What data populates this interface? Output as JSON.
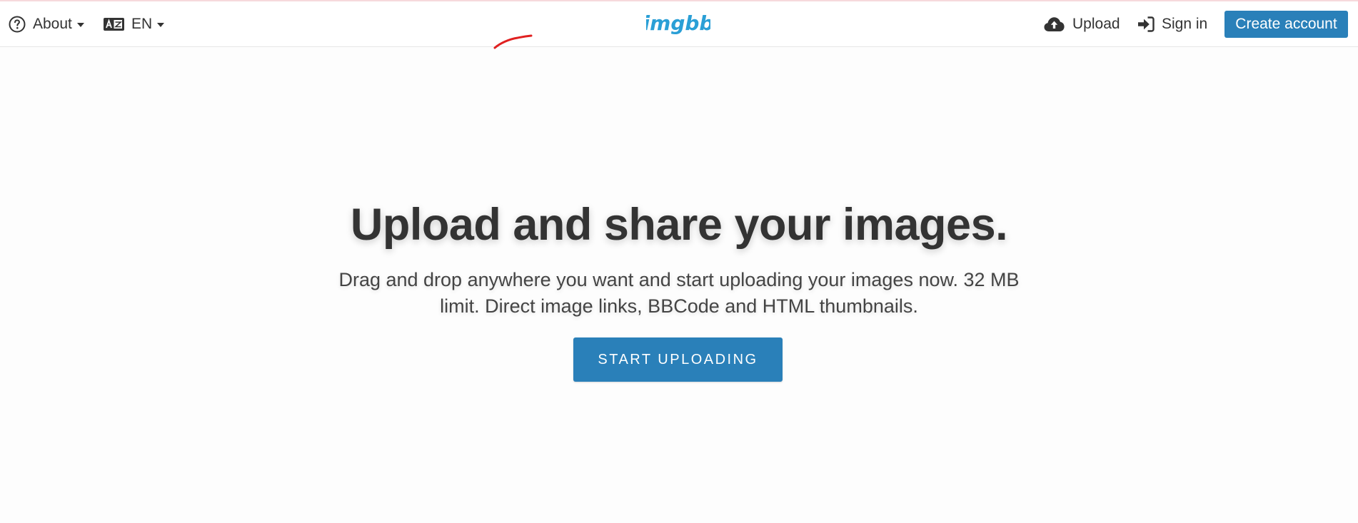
{
  "header": {
    "about_label": "About",
    "language_label": "EN",
    "logo_text": "imgbb",
    "upload_label": "Upload",
    "signin_label": "Sign in",
    "create_account_label": "Create account"
  },
  "hero": {
    "title": "Upload and share your images.",
    "subtitle": "Drag and drop anywhere you want and start uploading your images now. 32 MB limit. Direct image links, BBCode and HTML thumbnails.",
    "start_button_label": "START UPLOADING"
  },
  "icons": {
    "about": "question-circle-icon",
    "language": "language-card-icon",
    "upload": "cloud-upload-icon",
    "signin": "sign-in-arrow-icon"
  },
  "colors": {
    "accent": "#2a80b9",
    "logo": "#2a9fd6",
    "annotation": "#e02020"
  }
}
